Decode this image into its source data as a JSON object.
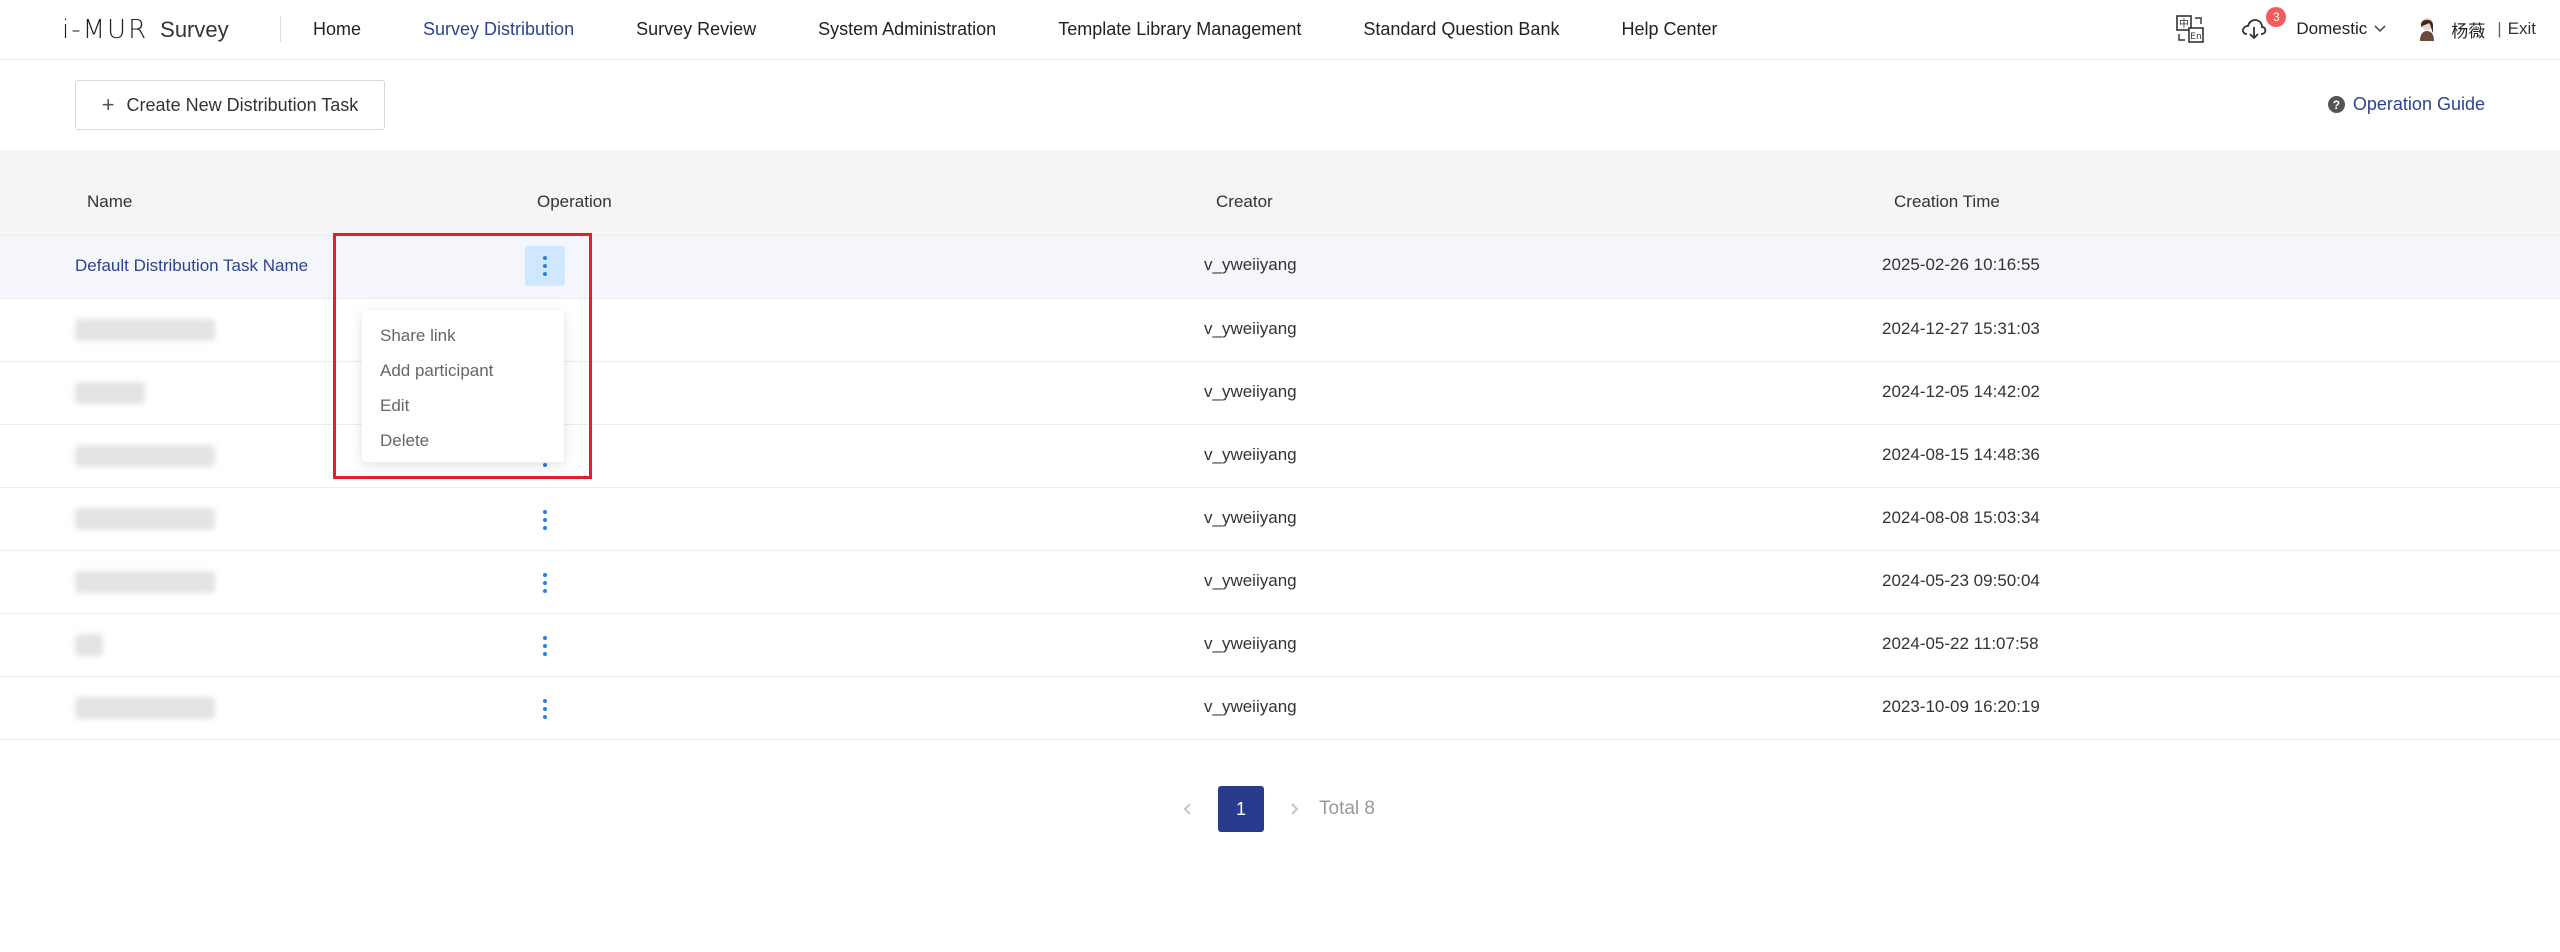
{
  "app": {
    "logo_mark": "i-MUR",
    "product": "Survey"
  },
  "nav": {
    "items": [
      {
        "label": "Home"
      },
      {
        "label": "Survey Distribution",
        "active": true
      },
      {
        "label": "Survey Review"
      },
      {
        "label": "System Administration"
      },
      {
        "label": "Template Library Management"
      },
      {
        "label": "Standard Question Bank"
      },
      {
        "label": "Help Center"
      }
    ]
  },
  "header_tools": {
    "translate_icon": "translate-icon",
    "download_icon": "cloud-download-icon",
    "download_badge": "3",
    "region": "Domestic",
    "user_name": "杨薇",
    "separator": "|",
    "exit": "Exit"
  },
  "toolbar": {
    "create_label": "Create New Distribution Task",
    "plus_glyph": "+",
    "guide_label": "Operation Guide",
    "guide_glyph": "?"
  },
  "table": {
    "columns": [
      "Name",
      "Operation",
      "Creator",
      "Creation Time"
    ],
    "rows": [
      {
        "name": "Default Distribution Task Name",
        "creator": "v_yweiiyang",
        "time": "2025-02-26 10:16:55"
      },
      {
        "name": "",
        "creator": "v_yweiiyang",
        "time": "2024-12-27 15:31:03"
      },
      {
        "name": "",
        "creator": "v_yweiiyang",
        "time": "2024-12-05 14:42:02"
      },
      {
        "name": "",
        "creator": "v_yweiiyang",
        "time": "2024-08-15 14:48:36"
      },
      {
        "name": "",
        "creator": "v_yweiiyang",
        "time": "2024-08-08 15:03:34"
      },
      {
        "name": "",
        "creator": "v_yweiiyang",
        "time": "2024-05-23 09:50:04"
      },
      {
        "name": "",
        "creator": "v_yweiiyang",
        "time": "2024-05-22 11:07:58"
      },
      {
        "name": "",
        "creator": "v_yweiiyang",
        "time": "2023-10-09 16:20:19"
      }
    ]
  },
  "operation_menu": {
    "items": [
      "Share link",
      "Add participant",
      "Edit",
      "Delete"
    ]
  },
  "pagination": {
    "current_page": "1",
    "total": "Total 8"
  },
  "colors": {
    "accent": "#2e4390",
    "page_active": "#2a3a8c",
    "dots": "#2f7fd8",
    "highlight_box": "#e0202a",
    "badge": "#f45b5b"
  }
}
